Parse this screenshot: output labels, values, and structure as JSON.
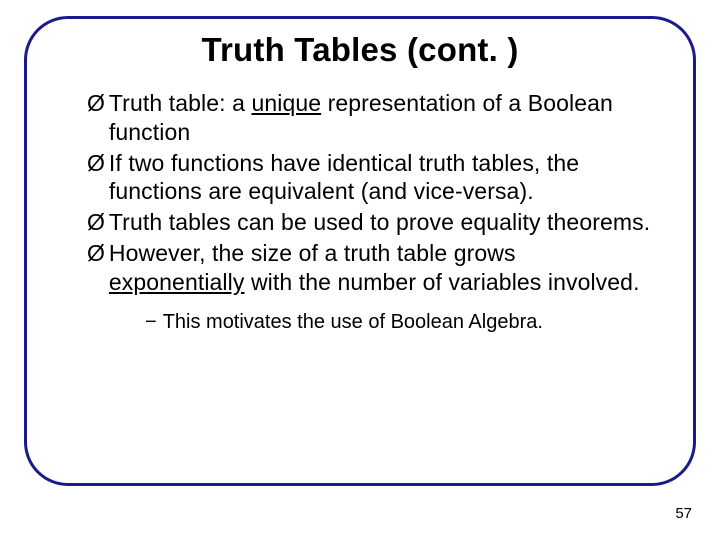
{
  "title": "Truth Tables (cont. )",
  "bullets": [
    {
      "pre": "Truth table: a ",
      "u": "unique",
      "post": " representation of a Boolean function"
    },
    {
      "pre": "If two functions have identical truth tables, the functions are equivalent (and vice-versa)."
    },
    {
      "pre": "Truth tables can be used to prove equality theorems."
    },
    {
      "pre": "However, the size of a truth table grows ",
      "u": "exponentially",
      "post": " with the number of variables involved."
    }
  ],
  "subbullets": [
    "This motivates the use of Boolean Algebra."
  ],
  "markers": {
    "bullet": "Ø",
    "sub": "−"
  },
  "page": "57"
}
